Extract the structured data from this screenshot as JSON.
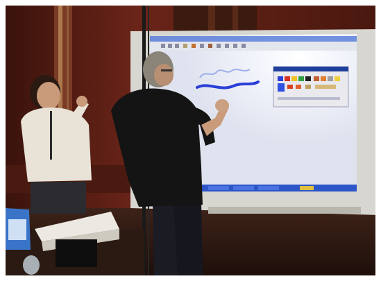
{
  "photo": {
    "alt": "",
    "colors": {
      "frame": "#ffffff",
      "wall": "#5a1e14",
      "wall_shadow": "#3a130c",
      "screen": "#eef0f8",
      "screen_glow": "#ffffff",
      "board_frame": "#d8d6d0",
      "taskbar": "#2c55c8",
      "palette_title": "#1f3f9c",
      "scribble": "#2a3fd6",
      "presenter_shirt": "#141414",
      "presenter_jeans": "#1b1b24",
      "observer_shirt": "#e9e2d6",
      "skin": "#c99b7a",
      "hair": "#8a8378",
      "table": "#2a1a12"
    }
  }
}
